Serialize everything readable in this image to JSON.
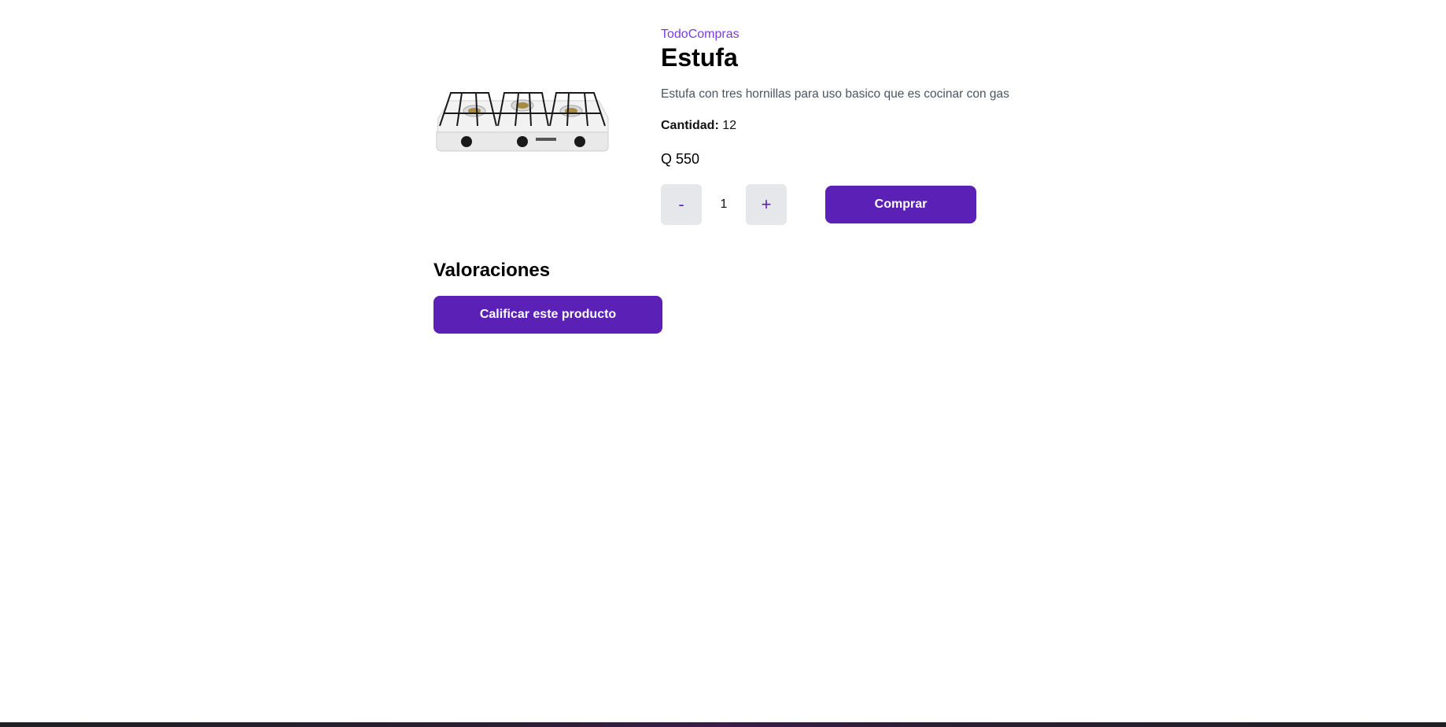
{
  "product": {
    "store": "TodoCompras",
    "title": "Estufa",
    "description": "Estufa con tres hornillas para uso basico que es cocinar con gas",
    "stock_label": "Cantidad:",
    "stock_value": "12",
    "price": "Q 550",
    "image_alt": "stove-product-image"
  },
  "purchase": {
    "minus_label": "-",
    "plus_label": "+",
    "quantity": "1",
    "buy_label": "Comprar"
  },
  "ratings": {
    "heading": "Valoraciones",
    "rate_label": "Calificar este producto"
  },
  "colors": {
    "accent": "#5b21b6",
    "store_link": "#7c3aed",
    "qty_bg": "#e5e7eb"
  }
}
